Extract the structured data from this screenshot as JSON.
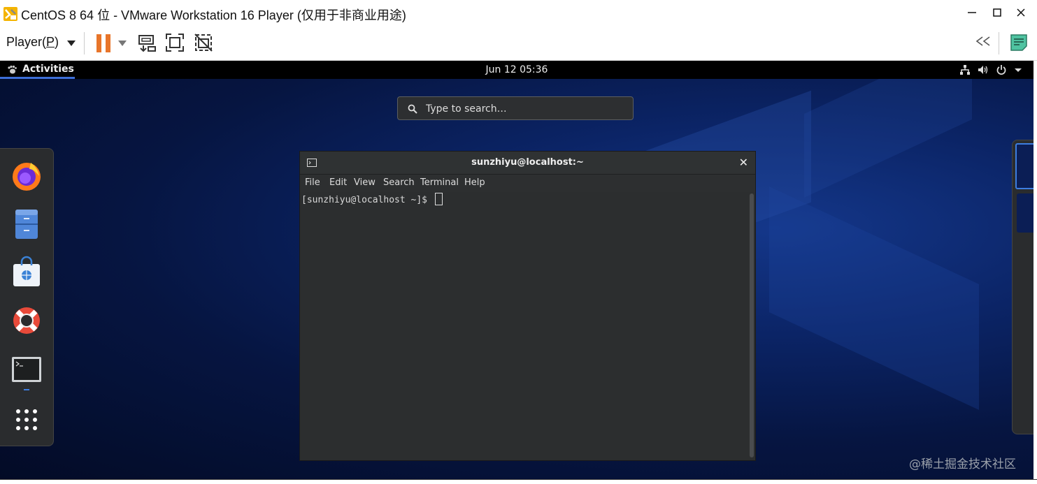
{
  "window": {
    "title": "CentOS 8 64 位 - VMware Workstation 16 Player (仅用于非商业用途)",
    "minimize_icon": "minimize-icon",
    "maximize_icon": "maximize-icon",
    "close_icon": "close-icon"
  },
  "toolbar": {
    "player_menu_label": "Player(",
    "player_menu_accel": "P",
    "player_menu_suffix": ")",
    "icons": [
      "pause-icon",
      "send-ctrl-alt-del-icon",
      "fullscreen-icon",
      "unity-icon",
      "collapse-icon",
      "notes-icon"
    ],
    "accent": "#e8752a"
  },
  "gnome": {
    "activities_label": "Activities",
    "clock": "Jun 12  05:36",
    "search_placeholder": "Type to search…",
    "dash_items": [
      "firefox-icon",
      "files-icon",
      "software-icon",
      "help-icon",
      "terminal-icon",
      "show-apps-icon"
    ]
  },
  "terminal": {
    "title": "sunzhiyu@localhost:~",
    "menu": [
      "File",
      "Edit",
      "View",
      "Search",
      "Terminal",
      "Help"
    ],
    "prompt": "[sunzhiyu@localhost ~]$ "
  },
  "watermark": "@稀土掘金技术社区"
}
